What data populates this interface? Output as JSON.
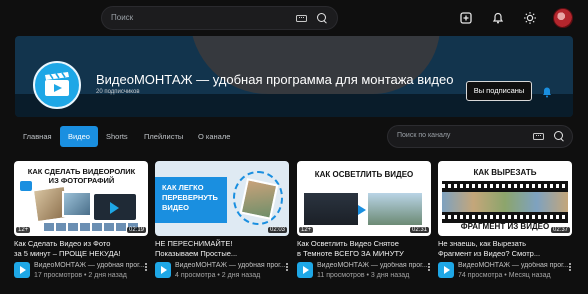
{
  "header": {
    "search_placeholder": "Поиск",
    "icons": [
      "keyboard-icon",
      "search-icon",
      "create-icon",
      "notifications-icon",
      "theme-icon",
      "avatar"
    ]
  },
  "channel": {
    "title": "ВидеоМОНТАЖ — удобная программа для монтажа видео",
    "subscribers": "20 подписчиков",
    "subscribed_label": "Вы подписаны",
    "accent": "#1a8fe0"
  },
  "tabs": [
    {
      "label": "Главная",
      "active": false
    },
    {
      "label": "Видео",
      "active": true
    },
    {
      "label": "Shorts",
      "active": false
    },
    {
      "label": "Плейлисты",
      "active": false
    },
    {
      "label": "О канале",
      "active": false
    }
  ],
  "channel_search_placeholder": "Поиск по каналу",
  "videos": [
    {
      "thumb_text": [
        "КАК СДЕЛАТЬ ВИДЕОРОЛИК",
        "ИЗ ФОТОГРАФИЙ"
      ],
      "age": "12+",
      "duration": "02:19",
      "title_line1": "Как Сделать Видео из Фото",
      "title_line2": "за 5 минут – ПРОЩЕ НЕКУДА!",
      "channel": "ВидеоМОНТАЖ — удобная прог...",
      "meta": "17 просмотров • 2 дня назад"
    },
    {
      "thumb_text": [
        "КАК ЛЕГКО",
        "ПЕРЕВЕРНУТЬ",
        "ВИДЕО"
      ],
      "age": "12+",
      "duration": "02:03",
      "title_line1": "НЕ ПЕРЕСНИМАЙТЕ!",
      "title_line2": "Показываем Простые...",
      "channel": "ВидеоМОНТАЖ — удобная прог...",
      "meta": "4 просмотра • 2 дня назад"
    },
    {
      "thumb_text": [
        "КАК ОСВЕТЛИТЬ ВИДЕО"
      ],
      "age": "12+",
      "duration": "02:31",
      "title_line1": "Как Осветлить Видео Снятое",
      "title_line2": "в Темноте ВСЕГО ЗА МИНУТУ",
      "channel": "ВидеоМОНТАЖ — удобная прог...",
      "meta": "11 просмотров • 3 дня назад"
    },
    {
      "thumb_text": [
        "КАК ВЫРЕЗАТЬ",
        "ФРАГМЕНТ ИЗ ВИДЕО"
      ],
      "age": "12+",
      "duration": "02:37",
      "title_line1": "Не знаешь, как Вырезать",
      "title_line2": "Фрагмент из Видео? Смотр...",
      "channel": "ВидеоМОНТАЖ — удобная прог...",
      "meta": "74 просмотра • Месяц назад"
    }
  ]
}
